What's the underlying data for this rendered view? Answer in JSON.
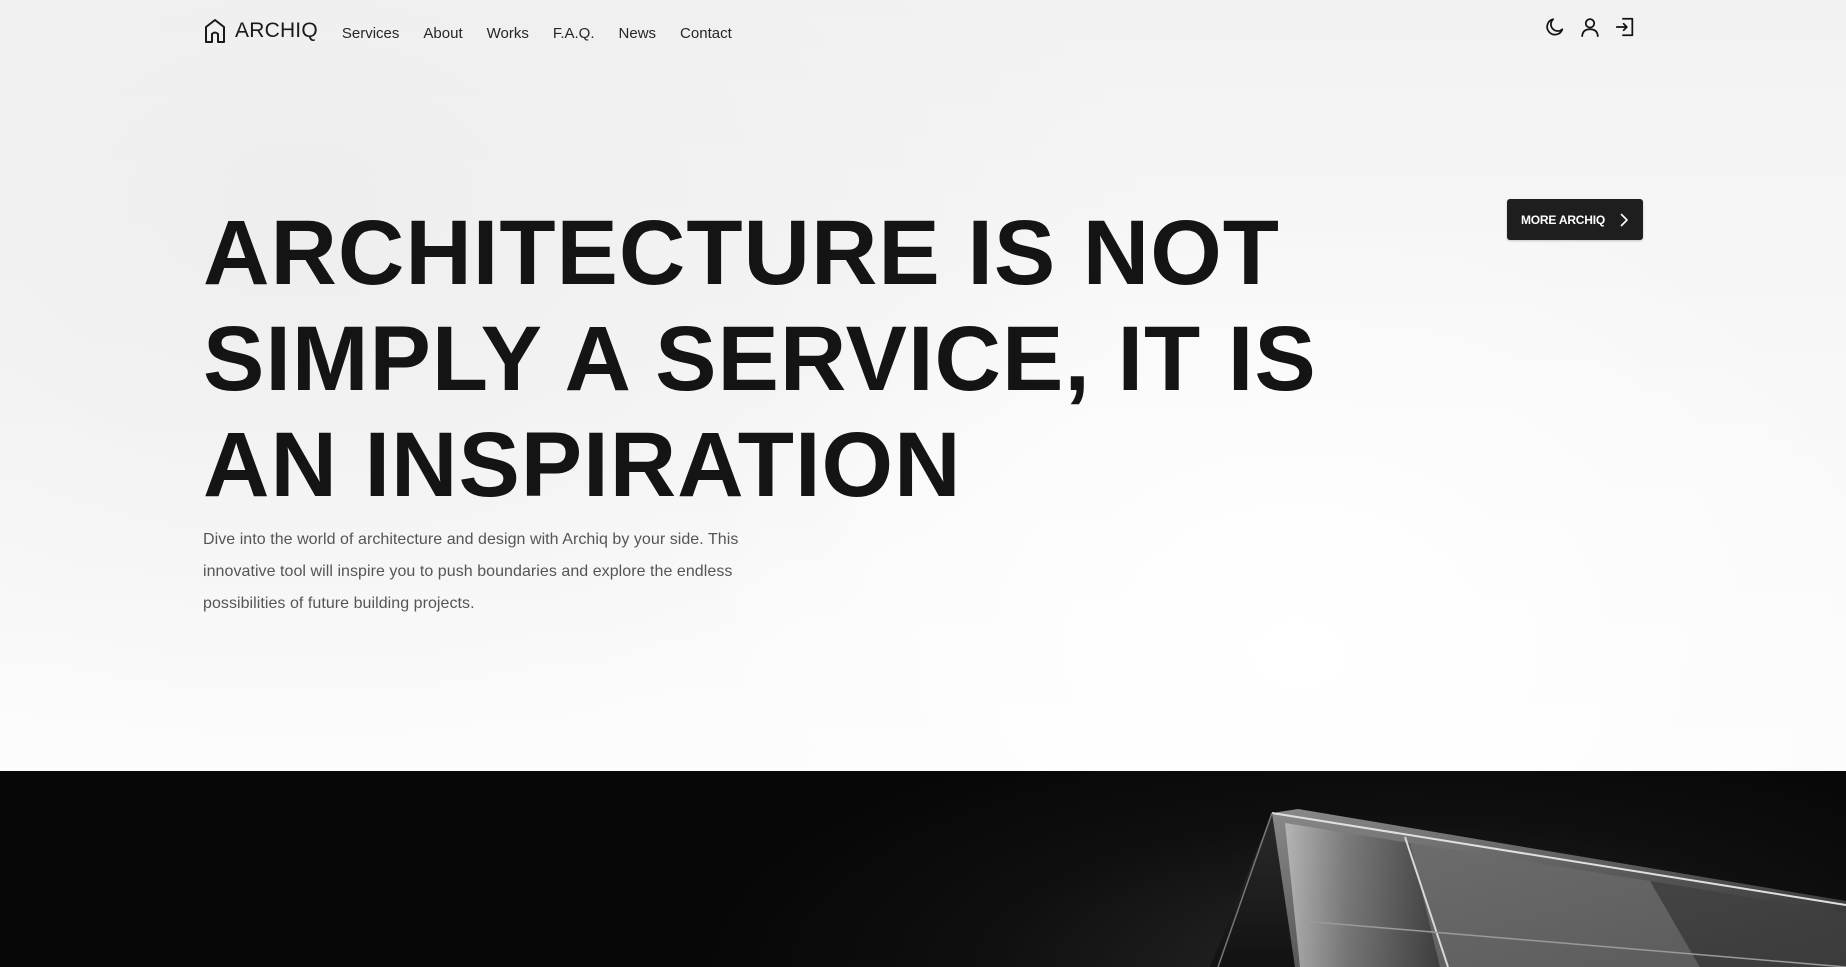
{
  "brand": {
    "name": "ARCHIQ",
    "icon": "house-outline-icon"
  },
  "nav": {
    "links": [
      "Services",
      "About",
      "Works",
      "F.A.Q.",
      "News",
      "Contact"
    ],
    "icons": [
      "moon-icon",
      "user-icon",
      "login-icon"
    ]
  },
  "hero": {
    "cta_label": "MORE ARCHIQ",
    "headline_lines": [
      "ARCHITECTURE IS NOT",
      "SIMPLY A SERVICE, IT IS",
      "AN INSPIRATION"
    ],
    "intro": "Dive into the world of architecture and design with Archiq by your side. This innovative tool will inspire you to push boundaries and explore the endless possibilities of future building projects."
  },
  "colors": {
    "primary_dark": "#1e1e1e",
    "text": "#141414",
    "muted": "#555555",
    "background": "#f7f7f7"
  }
}
